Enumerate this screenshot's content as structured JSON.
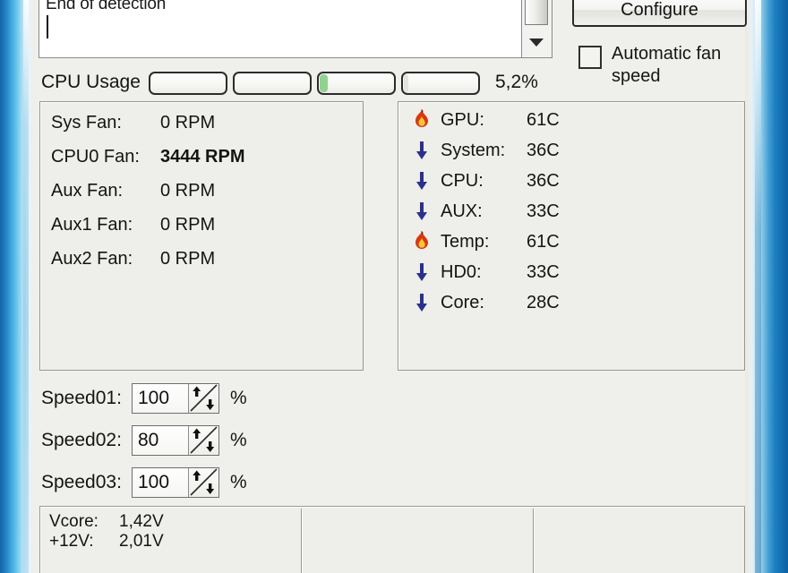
{
  "log": {
    "text": "End of detection",
    "caret": "|",
    "scrollbar": {
      "thumb_name": "scrollbar-thumb",
      "down_arrow_icon": "chevron-down-icon"
    }
  },
  "toolbar": {
    "configure_label": "Configure",
    "auto_fan_label": "Automatic fan speed",
    "auto_fan_checked": false
  },
  "cpu_usage": {
    "label": "CPU Usage",
    "percent_text": "5,2%",
    "bars": [
      {
        "name": "cpu-bar-1",
        "fill_percent": 0,
        "fill_color": "#ffffff"
      },
      {
        "name": "cpu-bar-2",
        "fill_percent": 0,
        "fill_color": "#ffffff"
      },
      {
        "name": "cpu-bar-3",
        "fill_percent": 11,
        "fill_color": "#8fd38f"
      },
      {
        "name": "cpu-bar-4",
        "fill_percent": 6,
        "fill_color": "#e4e4e0"
      }
    ]
  },
  "fans": {
    "rows": [
      {
        "name": "Sys Fan:",
        "value": "0 RPM",
        "bold": false
      },
      {
        "name": "CPU0 Fan:",
        "value": "3444 RPM",
        "bold": true
      },
      {
        "name": "Aux Fan:",
        "value": "0 RPM",
        "bold": false
      },
      {
        "name": "Aux1 Fan:",
        "value": "0 RPM",
        "bold": false
      },
      {
        "name": "Aux2 Fan:",
        "value": "0 RPM",
        "bold": false
      }
    ]
  },
  "temperatures": {
    "rows": [
      {
        "icon": "flame-icon",
        "name": "GPU:",
        "value": "61C"
      },
      {
        "icon": "arrow-down-icon",
        "name": "System:",
        "value": "36C"
      },
      {
        "icon": "arrow-down-icon",
        "name": "CPU:",
        "value": "36C"
      },
      {
        "icon": "arrow-down-icon",
        "name": "AUX:",
        "value": "33C"
      },
      {
        "icon": "flame-icon",
        "name": "Temp:",
        "value": "61C"
      },
      {
        "icon": "arrow-down-icon",
        "name": "HD0:",
        "value": "33C"
      },
      {
        "icon": "arrow-down-icon",
        "name": "Core:",
        "value": "28C"
      }
    ]
  },
  "speeds": {
    "unit": "%",
    "rows": [
      {
        "label": "Speed01:",
        "value": "100"
      },
      {
        "label": "Speed02:",
        "value": "80"
      },
      {
        "label": "Speed03:",
        "value": "100"
      }
    ]
  },
  "voltages": {
    "rows": [
      {
        "name": "Vcore:",
        "value": "1,42V"
      },
      {
        "name": "+12V:",
        "value": "2,01V"
      }
    ]
  },
  "colors": {
    "frame_blue": "#1d7fc0",
    "flame_red": "#d83712",
    "flame_yellow": "#f6c83a",
    "arrow_blue": "#2b2f8f",
    "bar_green": "#8fd38f",
    "panel_bg": "#eeeeea"
  }
}
